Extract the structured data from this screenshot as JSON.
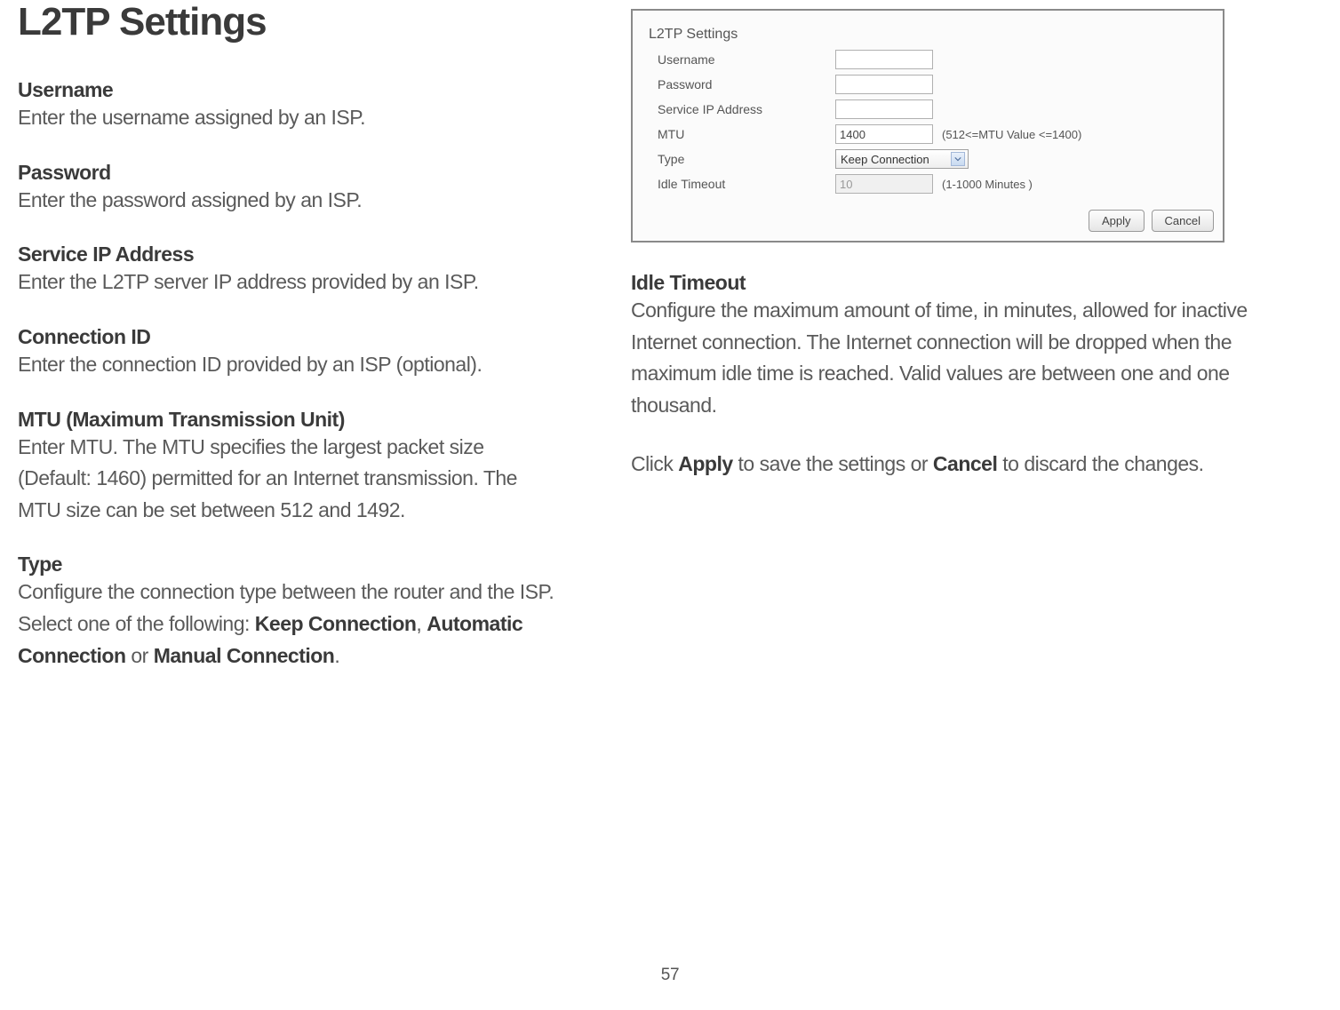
{
  "page_title": "L2TP Settings",
  "page_number": "57",
  "left_sections": {
    "username_h": "Username",
    "username_b": "Enter the username assigned by an ISP.",
    "password_h": "Password",
    "password_b": "Enter the password assigned by an ISP.",
    "serviceip_h": "Service IP Address",
    "serviceip_b": "Enter the L2TP server IP address provided by an ISP.",
    "connid_h": "Connection ID",
    "connid_b": "Enter the connection ID provided by an ISP (optional).",
    "mtu_h": "MTU (Maximum Transmission Unit)",
    "mtu_b": "Enter MTU. The MTU specifies the largest packet size (Default: 1460) permitted for an Internet transmission. The MTU size can be set between 512 and 1492.",
    "type_h": "Type",
    "type_pre": "Configure the connection type between the router and the ISP. Select one of the following: ",
    "type_opt1": "Keep Connection",
    "type_sep1": ", ",
    "type_opt2": "Automatic Connection",
    "type_sep2": " or ",
    "type_opt3": "Manual Connection",
    "type_end": "."
  },
  "right_sections": {
    "idle_h": "Idle Timeout",
    "idle_b": "Configure the maximum amount of time, in minutes, allowed for inactive Internet connection. The Internet connection will be dropped when the maximum idle time is reached. Valid values are between one and one thousand.",
    "footer_pre": "Click ",
    "footer_apply": "Apply",
    "footer_mid": " to save the settings or ",
    "footer_cancel": "Cancel",
    "footer_end": " to discard the changes."
  },
  "panel": {
    "title": "L2TP Settings",
    "rows": {
      "username_label": "Username",
      "password_label": "Password",
      "serviceip_label": "Service IP Address",
      "mtu_label": "MTU",
      "mtu_value": "1400",
      "mtu_hint": "(512<=MTU Value <=1400)",
      "type_label": "Type",
      "type_value": "Keep Connection",
      "idle_label": "Idle Timeout",
      "idle_value": "10",
      "idle_hint": "(1-1000 Minutes )"
    },
    "apply_btn": "Apply",
    "cancel_btn": "Cancel"
  }
}
